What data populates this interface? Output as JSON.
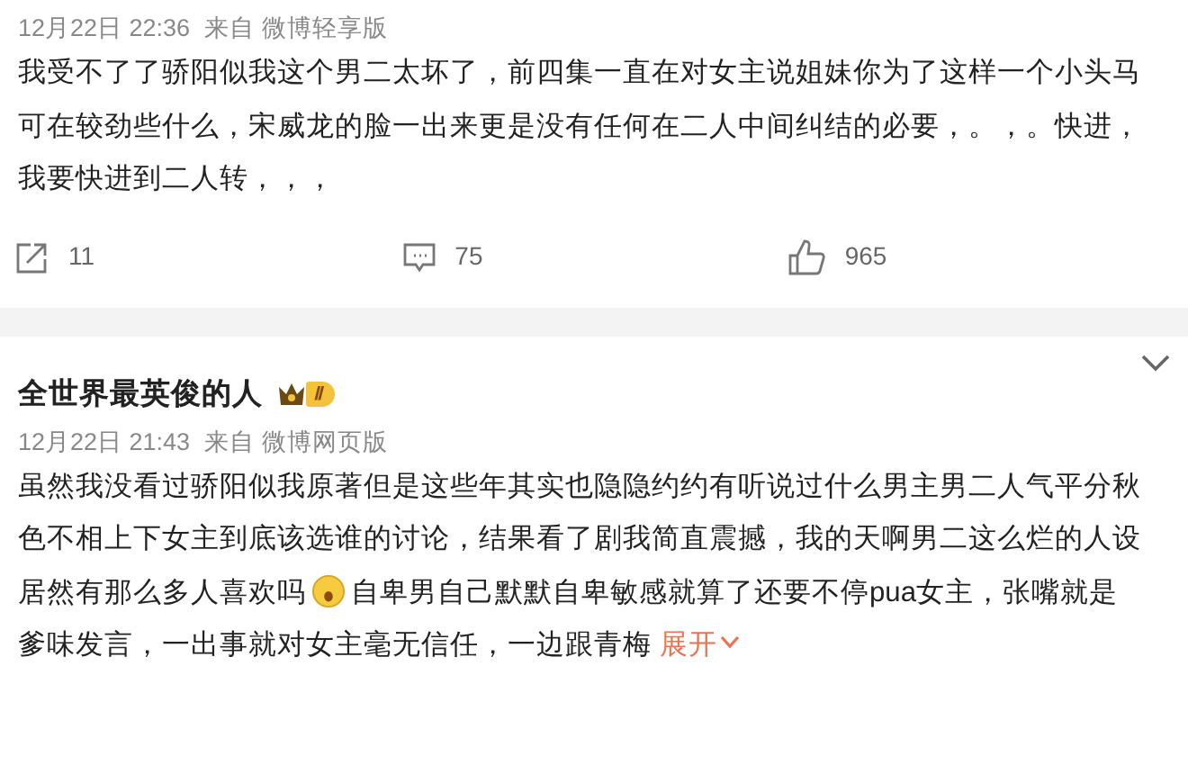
{
  "posts": [
    {
      "time": "12月22日 22:36",
      "source": "来自 微博轻享版",
      "text": "我受不了了骄阳似我这个男二太坏了，前四集一直在对女主说姐妹你为了这样一个小头马可在较劲些什么，宋威龙的脸一出来更是没有任何在二人中间纠结的必要，。，。快进，我要快进到二人转，，，",
      "actions": [
        {
          "kind": "repost",
          "count": "11"
        },
        {
          "kind": "comment",
          "count": "75"
        },
        {
          "kind": "like",
          "count": "965"
        }
      ]
    },
    {
      "author": "全世界最英俊的人",
      "badge": "Ⅱ",
      "time": "12月22日 21:43",
      "source": "来自 微博网页版",
      "text_parts": [
        "虽然我没看过骄阳似我原著但是这些年其实也隐隐约约有听说过什么男主男二人气平分秋色不相上下女主到底该选谁的讨论，结果看了剧我简直震撼，我的天啊男二这么烂的人设居然有那么多人喜欢吗",
        "自卑男自己默默自卑敏感就算了还要不停pua女主，张嘴就是爹味发言，一出事就对女主毫无信任，一边跟青梅"
      ],
      "expand": "展开"
    }
  ]
}
